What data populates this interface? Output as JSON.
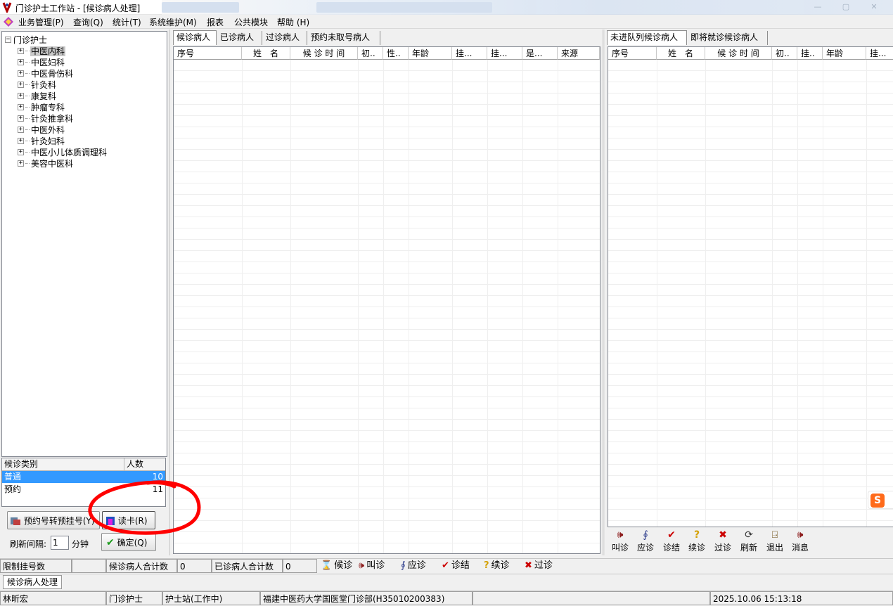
{
  "window": {
    "title": "门诊护士工作站 - [候诊病人处理]"
  },
  "menu": [
    {
      "label": "业务管理(P)"
    },
    {
      "label": "查询(Q)"
    },
    {
      "label": "统计(T)"
    },
    {
      "label": "系统维护(M)"
    },
    {
      "label": "报表"
    },
    {
      "label": "公共模块"
    },
    {
      "label": "帮助 (H)"
    }
  ],
  "tree": {
    "root": "门诊护士",
    "departments": [
      "中医内科",
      "中医妇科",
      "中医骨伤科",
      "针灸科",
      "康复科",
      "肿瘤专科",
      "针灸推拿科",
      "中医外科",
      "针灸妇科",
      "中医小儿体质调理科",
      "美容中医科"
    ],
    "selected": "中医内科"
  },
  "queue_summary": {
    "headers": [
      "候诊类别",
      "人数"
    ],
    "rows": [
      {
        "type": "普通",
        "count": "10"
      },
      {
        "type": "预约",
        "count": "11"
      }
    ]
  },
  "left_buttons": {
    "convert": "预约号转预挂号(Y)",
    "read_card": "读卡(R)",
    "refresh_label": "刷新间隔:",
    "refresh_value": "1",
    "refresh_unit": "分钟",
    "confirm": "确定(Q)"
  },
  "center": {
    "tabs": [
      "候诊病人",
      "已诊病人",
      "过诊病人",
      "预约未取号病人"
    ],
    "active_tab": 0,
    "columns": [
      "序号",
      "姓　名",
      "候 诊 时 间",
      "初..",
      "性..",
      "年龄",
      "挂...",
      "挂...",
      "是...",
      "来源"
    ]
  },
  "right": {
    "tabs": [
      "未进队列候诊病人",
      "即将就诊候诊病人"
    ],
    "active_tab": 0,
    "columns": [
      "序号",
      "姓　名",
      "候 诊 时 间",
      "初..",
      "挂..",
      "年龄",
      "挂..."
    ],
    "toolbar": [
      {
        "label": "叫诊",
        "icon": "speaker-icon"
      },
      {
        "label": "应诊",
        "icon": "stethoscope-icon"
      },
      {
        "label": "诊结",
        "icon": "checkmark-icon"
      },
      {
        "label": "续诊",
        "icon": "question-icon"
      },
      {
        "label": "过诊",
        "icon": "cross-icon"
      },
      {
        "label": "刷新",
        "icon": "refresh-icon"
      },
      {
        "label": "退出",
        "icon": "exit-icon"
      },
      {
        "label": "消息",
        "icon": "message-icon"
      }
    ]
  },
  "stats_bar": {
    "limit_label": "限制挂号数",
    "waiting_label": "候诊病人合计数",
    "waiting_value": "0",
    "done_label": "已诊病人合计数",
    "done_value": "0",
    "legend": [
      {
        "label": "候诊",
        "icon": "hourglass-icon",
        "color": "#c8a000"
      },
      {
        "label": "叫诊",
        "icon": "speaker-icon",
        "color": "#8b1a1a"
      },
      {
        "label": "应诊",
        "icon": "stethoscope-icon",
        "color": "#2a3a8a"
      },
      {
        "label": "诊结",
        "icon": "checkmark-icon",
        "color": "#cc0000"
      },
      {
        "label": "续诊",
        "icon": "question-icon",
        "color": "#d4a000"
      },
      {
        "label": "过诊",
        "icon": "cross-icon",
        "color": "#cc0000"
      }
    ]
  },
  "window_tabs": [
    "候诊病人处理"
  ],
  "status_bar": {
    "user": "林昕宏",
    "role": "门诊护士",
    "station": "护士站(工作中)",
    "org": "福建中医药大学国医堂门诊部(H35010200383)",
    "datetime": "2025.10.06 15:13:18"
  },
  "colors": {
    "selection": "#3399ff",
    "annotation": "#ff0000"
  }
}
